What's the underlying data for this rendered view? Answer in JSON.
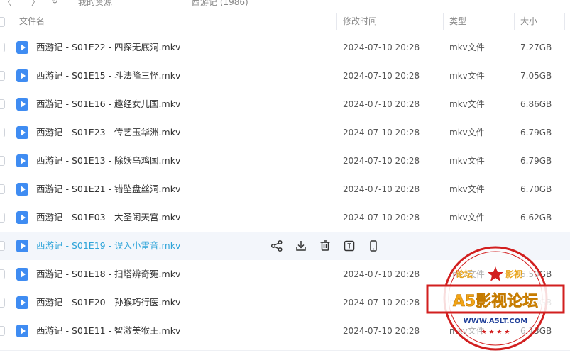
{
  "topbar": {
    "crumbs": [
      "〈",
      "〉",
      "↻",
      "我的资源",
      "西游记 (1986)"
    ]
  },
  "columns": {
    "name": "文件名",
    "modified": "修改时间",
    "type": "类型",
    "size": "大小"
  },
  "files": [
    {
      "name": "西游记 - S01E22 - 四探无底洞.mkv",
      "time": "2024-07-10 20:28",
      "type": "mkv文件",
      "size": "7.27GB"
    },
    {
      "name": "西游记 - S01E15 - 斗法降三怪.mkv",
      "time": "2024-07-10 20:28",
      "type": "mkv文件",
      "size": "7.05GB"
    },
    {
      "name": "西游记 - S01E16 - 趣经女儿国.mkv",
      "time": "2024-07-10 20:28",
      "type": "mkv文件",
      "size": "6.86GB"
    },
    {
      "name": "西游记 - S01E23 - 传艺玉华洲.mkv",
      "time": "2024-07-10 20:28",
      "type": "mkv文件",
      "size": "6.79GB"
    },
    {
      "name": "西游记 - S01E13 - 除妖乌鸡国.mkv",
      "time": "2024-07-10 20:28",
      "type": "mkv文件",
      "size": "6.79GB"
    },
    {
      "name": "西游记 - S01E21 - 错坠盘丝洞.mkv",
      "time": "2024-07-10 20:28",
      "type": "mkv文件",
      "size": "6.70GB"
    },
    {
      "name": "西游记 - S01E03 - 大圣闹天宫.mkv",
      "time": "2024-07-10 20:28",
      "type": "mkv文件",
      "size": "6.62GB"
    },
    {
      "name": "西游记 - S01E19 - 误入小雷音.mkv",
      "time": "",
      "type": "",
      "size": ""
    },
    {
      "name": "西游记 - S01E18 - 扫塔辨奇冤.mkv",
      "time": "2024-07-10 20:28",
      "type": "mkv文件",
      "size": "6.50GB"
    },
    {
      "name": "西游记 - S01E20 - 孙猴巧行医.mkv",
      "time": "2024-07-10 20:28",
      "type": "mkv文件",
      "size": "6.48GB"
    },
    {
      "name": "西游记 - S01E11 - 智激美猴王.mkv",
      "time": "2024-07-10 20:28",
      "type": "mkv文件",
      "size": "6.13GB"
    }
  ],
  "hover_actions": [
    "share-icon",
    "download-icon",
    "delete-icon",
    "rename-icon",
    "mobile-icon"
  ],
  "watermark": {
    "top_left": "论坛",
    "top_right": "影视",
    "main": "A5影视论坛",
    "url": "WWW.A5LT.COM"
  },
  "colors": {
    "accent": "#2ea4d9",
    "file_icon": "#3f8cf2",
    "row_hover": "#f3f6fb",
    "watermark_red": "#d21f1f"
  }
}
